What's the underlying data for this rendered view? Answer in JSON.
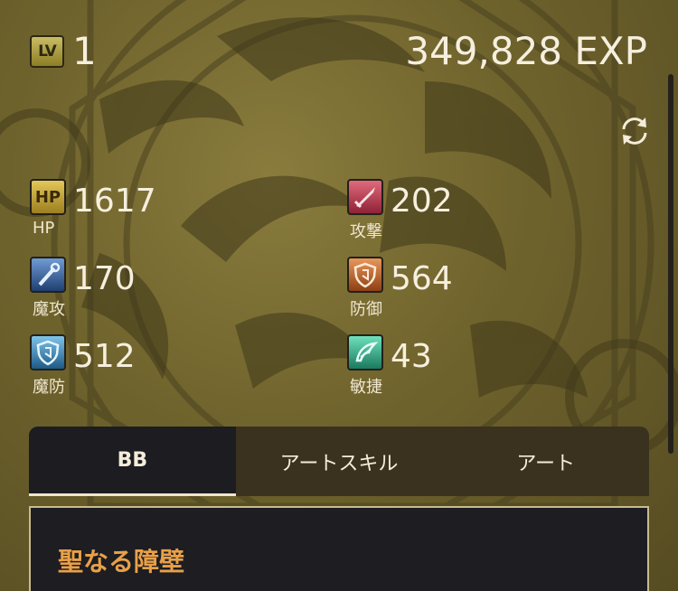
{
  "level": {
    "icon_text": "LV",
    "value": "1"
  },
  "exp": {
    "text": "349,828 EXP"
  },
  "stats": [
    {
      "icon_text": "HP",
      "value": "1617",
      "label": "HP",
      "color": "#c9a83c"
    },
    {
      "icon_text": "",
      "value": "202",
      "label": "攻撃",
      "color": "#c8455a"
    },
    {
      "icon_text": "",
      "value": "170",
      "label": "魔攻",
      "color": "#3c6aa8"
    },
    {
      "icon_text": "",
      "value": "564",
      "label": "防御",
      "color": "#c66a2e"
    },
    {
      "icon_text": "",
      "value": "512",
      "label": "魔防",
      "color": "#3a7fb0"
    },
    {
      "icon_text": "",
      "value": "43",
      "label": "敏捷",
      "color": "#2f9f86"
    }
  ],
  "tabs": [
    {
      "label": "BB",
      "active": true
    },
    {
      "label": "アートスキル",
      "active": false
    },
    {
      "label": "アート",
      "active": false
    }
  ],
  "panel": {
    "title": "聖なる障壁"
  },
  "icons": {
    "refresh": "refresh-icon",
    "level": "level-icon"
  },
  "colors": {
    "accent": "#e8a048",
    "tab_bar": "#3a321f",
    "panel_bg": "#1d1d22"
  }
}
